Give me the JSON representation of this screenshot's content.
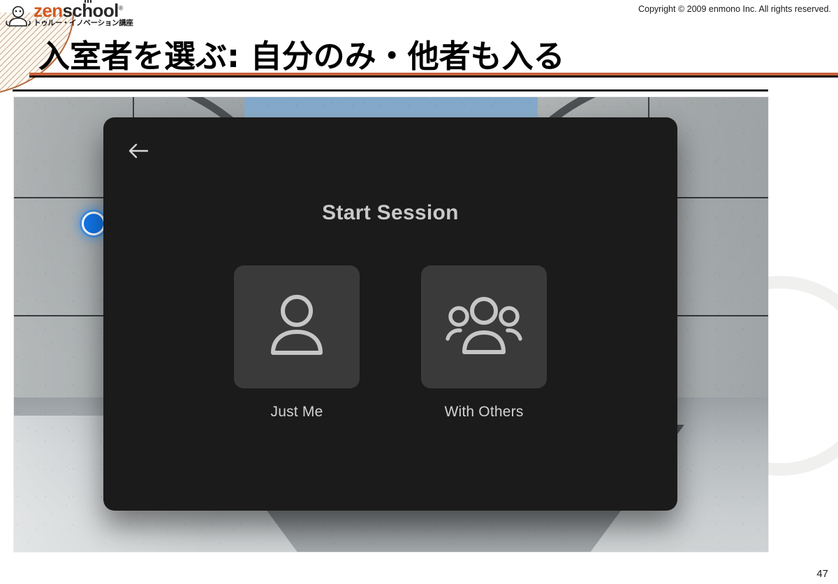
{
  "slide": {
    "title": "入室者を選ぶ: 自分のみ・他者も入る",
    "page_number": "47",
    "copyright": "Copyright © 2009 enmono Inc. All rights reserved.",
    "accent_color": "#c8603a",
    "rule_color": "#111111"
  },
  "logo": {
    "word_zen": "zen",
    "word_school": "school",
    "registered_mark": "®",
    "subtitle": "トゥルー・イノベーション講座",
    "zen_color": "#d4581f",
    "school_color": "#2a2a2a"
  },
  "screenshot": {
    "app_modal": {
      "title": "Start Session",
      "back_label": "Back",
      "background_color": "#1b1b1b",
      "tile_color": "#3a3a3a",
      "text_color": "#c9c9c9",
      "options": [
        {
          "label": "Just Me",
          "icon": "single-person-icon"
        },
        {
          "label": "With Others",
          "icon": "group-people-icon"
        }
      ]
    },
    "cursor": {
      "color": "#1176e8",
      "label": "pointer-dot"
    },
    "environment": "VR concrete hall with arched openings and sky"
  }
}
